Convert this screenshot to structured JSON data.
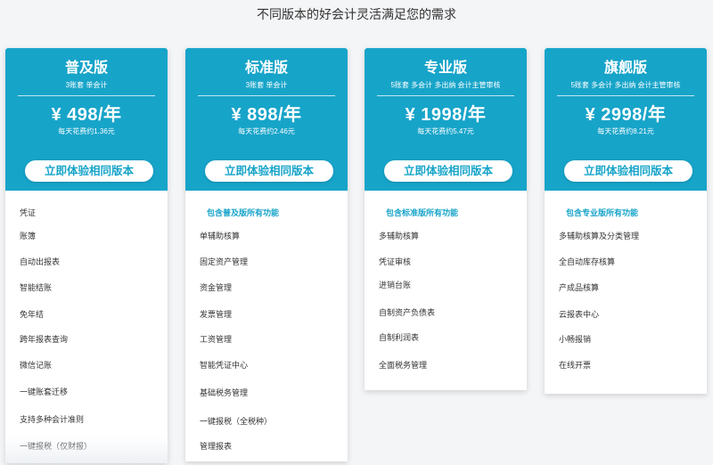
{
  "title": "不同版本的好会计灵活满足您的需求",
  "accent_color": "#17a4c9",
  "plans": [
    {
      "name": "普及版",
      "subtitle": "3账套 单会计",
      "price": "¥ 498/年",
      "per_day": "每天花费约1.36元",
      "cta": "立即体验相同版本",
      "features": [
        "凭证",
        "账簿",
        "自动出报表",
        "智能结账",
        "免年结",
        "跨年报表查询",
        "微信记账",
        "一键账套迁移",
        "支持多种会计准则",
        "一键报税（仅财报）"
      ]
    },
    {
      "name": "标准版",
      "subtitle": "3账套 单会计",
      "price": "¥ 898/年",
      "per_day": "每天花费约2.46元",
      "cta": "立即体验相同版本",
      "includes": "包含普及版所有功能",
      "features": [
        "单辅助核算",
        "固定资产管理",
        "资金管理",
        "发票管理",
        "工资管理",
        "智能凭证中心",
        "基础税务管理",
        "一键报税（全税种）",
        "管理报表"
      ]
    },
    {
      "name": "专业版",
      "subtitle": "5账套 多会计 多出纳 会计主管审核",
      "price": "¥ 1998/年",
      "per_day": "每天花费约5.47元",
      "cta": "立即体验相同版本",
      "includes": "包含标准版所有功能",
      "features": [
        "多辅助核算",
        "凭证审核",
        "进销台账",
        "自制资产负债表",
        "自制利润表",
        "全面税务管理"
      ]
    },
    {
      "name": "旗舰版",
      "subtitle": "5账套 多会计 多出纳 会计主管审核",
      "price": "¥ 2998/年",
      "per_day": "每天花费约8.21元",
      "cta": "立即体验相同版本",
      "includes": "包含专业版所有功能",
      "features": [
        "多辅助核算及分类管理",
        "全自动库存核算",
        "产成品核算",
        "云报表中心",
        "小畅报销",
        "在线开票"
      ]
    }
  ]
}
